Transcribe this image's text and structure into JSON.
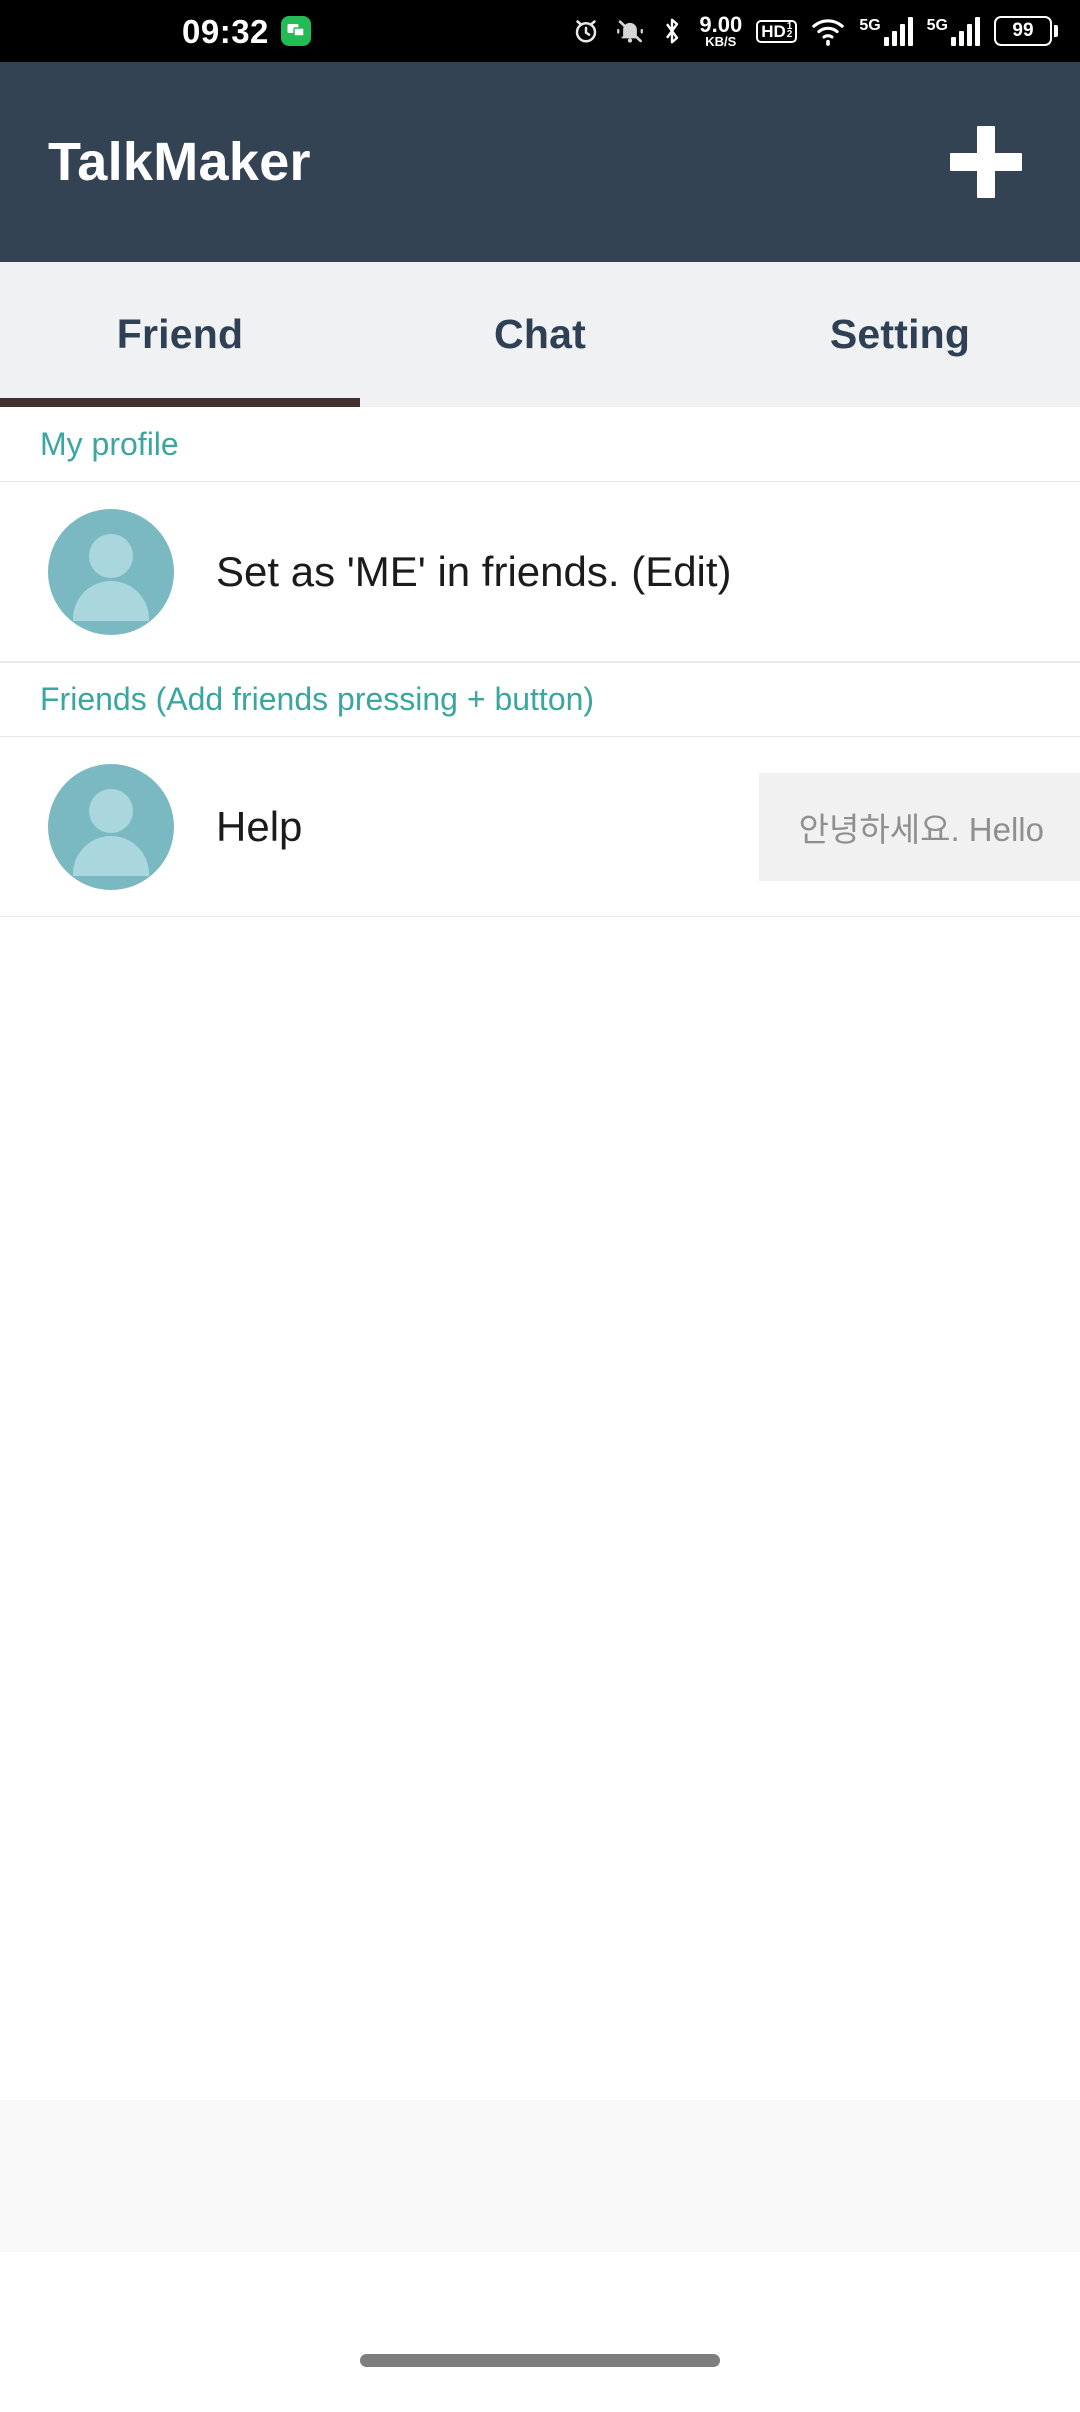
{
  "status_bar": {
    "time": "09:32",
    "notification_icon": "chat-bubble-icon",
    "alarm_icon": "alarm-clock-icon",
    "mute_icon": "bell-muted-icon",
    "bluetooth_icon": "bluetooth-icon",
    "net_speed_value": "9.00",
    "net_speed_unit": "KB/S",
    "hd_voice_label": "HD",
    "hd_voice_sup": "1",
    "hd_voice_sub": "2",
    "wifi_icon": "wifi-icon",
    "sim1_network": "5G",
    "sim2_network": "5G",
    "battery_level": "99"
  },
  "app_bar": {
    "title": "TalkMaker",
    "add_button_label": "+",
    "background_color": "#344354"
  },
  "tabs": [
    {
      "label": "Friend",
      "active": true
    },
    {
      "label": "Chat",
      "active": false
    },
    {
      "label": "Setting",
      "active": false
    }
  ],
  "tab_indicator_color": "#43302e",
  "accent_color": "#3aa69f",
  "sections": [
    {
      "header": "My profile",
      "rows": [
        {
          "name": "Set as 'ME' in friends. (Edit)",
          "avatar": "person-placeholder-avatar",
          "message": null
        }
      ]
    },
    {
      "header": "Friends (Add friends pressing + button)",
      "rows": [
        {
          "name": "Help",
          "avatar": "person-placeholder-avatar",
          "message": "안녕하세요. Hello"
        }
      ]
    }
  ],
  "bottom": {
    "banner_area": "ad-banner-placeholder",
    "gesture_pill": "home-gesture-pill"
  }
}
